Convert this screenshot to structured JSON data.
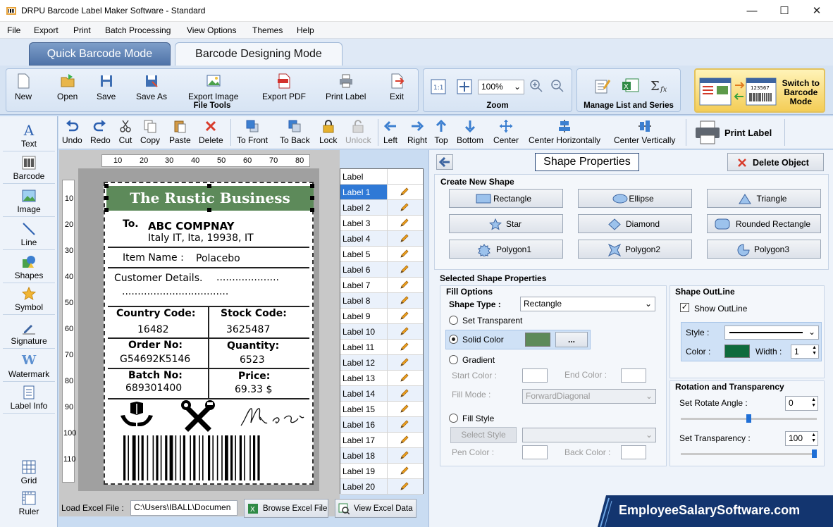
{
  "window": {
    "title": "DRPU Barcode Label Maker Software - Standard",
    "minimize": "—",
    "maximize": "☐",
    "close": "✕"
  },
  "menu": [
    "File",
    "Export",
    "Print",
    "Batch Processing",
    "View Options",
    "Themes",
    "Help"
  ],
  "modes": {
    "quick": "Quick Barcode Mode",
    "designing": "Barcode Designing Mode"
  },
  "ribbon": {
    "file_tools": {
      "title": "File Tools",
      "buttons": [
        "New",
        "Open",
        "Save",
        "Save As",
        "Export Image",
        "Export PDF",
        "Print Label",
        "Exit"
      ]
    },
    "zoom": {
      "title": "Zoom",
      "value": "100%"
    },
    "manage": {
      "title": "Manage List and Series"
    },
    "switch": {
      "line1": "Switch to",
      "line2": "Barcode",
      "line3": "Mode",
      "sample_number": "123567"
    }
  },
  "left_tools": [
    "Text",
    "Barcode",
    "Image",
    "Line",
    "Shapes",
    "Symbol",
    "Signature",
    "Watermark",
    "Label Info"
  ],
  "left_bottom": [
    "Grid",
    "Ruler"
  ],
  "toolbar": [
    "Undo",
    "Redo",
    "Cut",
    "Copy",
    "Paste",
    "Delete",
    "To Front",
    "To Back",
    "Lock",
    "Unlock",
    "Left",
    "Right",
    "Top",
    "Bottom",
    "Center",
    "Center Horizontally",
    "Center Vertically"
  ],
  "print_label": "Print Label",
  "ruler": {
    "top": [
      "10",
      "20",
      "30",
      "40",
      "50",
      "60",
      "70",
      "80"
    ],
    "left": [
      "10",
      "20",
      "30",
      "40",
      "50",
      "60",
      "70",
      "80",
      "90",
      "100",
      "110"
    ]
  },
  "label_design": {
    "business": "The Rustic Business",
    "to_prefix": "To.",
    "company": "ABC COMPNAY",
    "address": "Italy IT, Ita, 19938, IT",
    "item_label": "Item Name :",
    "item_value": "Polacebo",
    "customer_label": "Customer Details.",
    "customer_dots": "....................",
    "customer_dots2": "..................................",
    "country_label": "Country Code:",
    "country_value": "16482",
    "stock_label": "Stock Code:",
    "stock_value": "3625487",
    "order_label": "Order No:",
    "order_value": "G54692K5146",
    "qty_label": "Quantity:",
    "qty_value": "6523",
    "batch_label": "Batch No:",
    "batch_value": "689301400",
    "price_label": "Price:",
    "price_value": "69.33 $"
  },
  "label_list": {
    "header": "Label",
    "items": [
      "Label 1",
      "Label 2",
      "Label 3",
      "Label 4",
      "Label 5",
      "Label 6",
      "Label 7",
      "Label 8",
      "Label 9",
      "Label 10",
      "Label 11",
      "Label 12",
      "Label 13",
      "Label 14",
      "Label 15",
      "Label 16",
      "Label 17",
      "Label 18",
      "Label 19",
      "Label 20"
    ],
    "selected": 0
  },
  "load_excel": {
    "label": "Load Excel File :",
    "path": "C:\\Users\\IBALL\\Documen",
    "browse": "Browse Excel File",
    "view": "View Excel Data"
  },
  "props": {
    "title": "Shape Properties",
    "delete": "Delete Object",
    "create_title": "Create New Shape",
    "shapes": [
      "Rectangle",
      "Ellipse",
      "Triangle",
      "Star",
      "Diamond",
      "Rounded Rectangle",
      "Polygon1",
      "Polygon2",
      "Polygon3"
    ],
    "selected_title": "Selected Shape Properties",
    "fill_title": "Fill Options",
    "shape_type_label": "Shape Type :",
    "shape_type": "Rectangle",
    "set_transparent": "Set Transparent",
    "solid_color": "Solid Color",
    "solid_color_value": "#5d8a5a",
    "more": "...",
    "gradient": "Gradient",
    "start_color": "Start Color :",
    "end_color": "End Color :",
    "fill_mode_label": "Fill Mode :",
    "fill_mode": "ForwardDiagonal",
    "fill_style": "Fill Style",
    "select_style": "Select Style",
    "pen_color": "Pen Color :",
    "back_color": "Back Color :",
    "outline_title": "Shape OutLine",
    "show_outline": "Show OutLine",
    "style_label": "Style :",
    "color_label": "Color :",
    "outline_color": "#0f6b3c",
    "width_label": "Width :",
    "width": "1",
    "rotation_title": "Rotation and Transparency",
    "rotate_label": "Set Rotate Angle :",
    "rotate": "0",
    "rotate_fraction": 0.5,
    "transparency_label": "Set Transparency :",
    "transparency": "100",
    "transparency_fraction": 1.0
  },
  "banner": "EmployeeSalarySoftware.com"
}
